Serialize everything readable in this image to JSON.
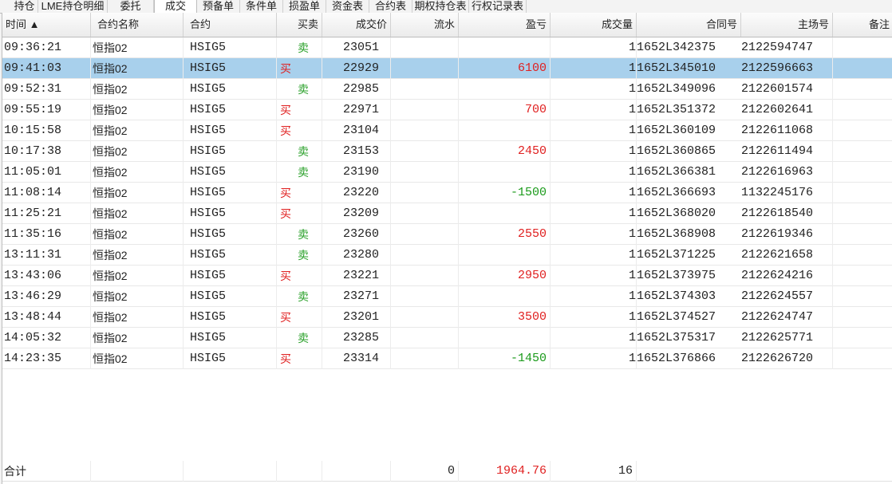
{
  "tabs": [
    "持仓",
    "LME持仓明细",
    "委托",
    "成交",
    "预备单",
    "条件单",
    "损盈单",
    "资金表",
    "合约表",
    "期权持仓表",
    "行权记录表"
  ],
  "active_tab": "成交",
  "columns": {
    "time": "时间 ▲",
    "name": "合约名称",
    "contract": "合约",
    "side": "买卖",
    "price": "成交价",
    "flow": "流水",
    "pnl": "盈亏",
    "qty": "成交量",
    "contract_no": "合同号",
    "host_no": "主场号",
    "remark": "备注"
  },
  "rows": [
    {
      "time": "09:36:21",
      "name": "恒指02",
      "contract": "HSIG5",
      "side": "卖",
      "price": "23051",
      "pnl": "",
      "qty": "1",
      "contract_no": "1652L342375",
      "host_no": "2122594747"
    },
    {
      "time": "09:41:03",
      "name": "恒指02",
      "contract": "HSIG5",
      "side": "买",
      "price": "22929",
      "pnl": "6100",
      "qty": "1",
      "contract_no": "1652L345010",
      "host_no": "2122596663"
    },
    {
      "time": "09:52:31",
      "name": "恒指02",
      "contract": "HSIG5",
      "side": "卖",
      "price": "22985",
      "pnl": "",
      "qty": "1",
      "contract_no": "1652L349096",
      "host_no": "2122601574"
    },
    {
      "time": "09:55:19",
      "name": "恒指02",
      "contract": "HSIG5",
      "side": "买",
      "price": "22971",
      "pnl": "700",
      "qty": "1",
      "contract_no": "1652L351372",
      "host_no": "2122602641"
    },
    {
      "time": "10:15:58",
      "name": "恒指02",
      "contract": "HSIG5",
      "side": "买",
      "price": "23104",
      "pnl": "",
      "qty": "1",
      "contract_no": "1652L360109",
      "host_no": "2122611068"
    },
    {
      "time": "10:17:38",
      "name": "恒指02",
      "contract": "HSIG5",
      "side": "卖",
      "price": "23153",
      "pnl": "2450",
      "qty": "1",
      "contract_no": "1652L360865",
      "host_no": "2122611494"
    },
    {
      "time": "11:05:01",
      "name": "恒指02",
      "contract": "HSIG5",
      "side": "卖",
      "price": "23190",
      "pnl": "",
      "qty": "1",
      "contract_no": "1652L366381",
      "host_no": "2122616963"
    },
    {
      "time": "11:08:14",
      "name": "恒指02",
      "contract": "HSIG5",
      "side": "买",
      "price": "23220",
      "pnl": "-1500",
      "qty": "1",
      "contract_no": "1652L366693",
      "host_no": "1132245176"
    },
    {
      "time": "11:25:21",
      "name": "恒指02",
      "contract": "HSIG5",
      "side": "买",
      "price": "23209",
      "pnl": "",
      "qty": "1",
      "contract_no": "1652L368020",
      "host_no": "2122618540"
    },
    {
      "time": "11:35:16",
      "name": "恒指02",
      "contract": "HSIG5",
      "side": "卖",
      "price": "23260",
      "pnl": "2550",
      "qty": "1",
      "contract_no": "1652L368908",
      "host_no": "2122619346"
    },
    {
      "time": "13:11:31",
      "name": "恒指02",
      "contract": "HSIG5",
      "side": "卖",
      "price": "23280",
      "pnl": "",
      "qty": "1",
      "contract_no": "1652L371225",
      "host_no": "2122621658"
    },
    {
      "time": "13:43:06",
      "name": "恒指02",
      "contract": "HSIG5",
      "side": "买",
      "price": "23221",
      "pnl": "2950",
      "qty": "1",
      "contract_no": "1652L373975",
      "host_no": "2122624216"
    },
    {
      "time": "13:46:29",
      "name": "恒指02",
      "contract": "HSIG5",
      "side": "卖",
      "price": "23271",
      "pnl": "",
      "qty": "1",
      "contract_no": "1652L374303",
      "host_no": "2122624557"
    },
    {
      "time": "13:48:44",
      "name": "恒指02",
      "contract": "HSIG5",
      "side": "买",
      "price": "23201",
      "pnl": "3500",
      "qty": "1",
      "contract_no": "1652L374527",
      "host_no": "2122624747"
    },
    {
      "time": "14:05:32",
      "name": "恒指02",
      "contract": "HSIG5",
      "side": "卖",
      "price": "23285",
      "pnl": "",
      "qty": "1",
      "contract_no": "1652L375317",
      "host_no": "2122625771"
    },
    {
      "time": "14:23:35",
      "name": "恒指02",
      "contract": "HSIG5",
      "side": "买",
      "price": "23314",
      "pnl": "-1450",
      "qty": "1",
      "contract_no": "1652L376866",
      "host_no": "2122626720"
    }
  ],
  "selected_row": 1,
  "total": {
    "label": "合计",
    "flow": "0",
    "pnl": "1964.76",
    "qty": "16"
  },
  "colors": {
    "buy": "#e02020",
    "sell": "#2aa02a",
    "profit": "#e02020",
    "loss": "#1a9a1a",
    "selected": "#a8d0ec"
  }
}
